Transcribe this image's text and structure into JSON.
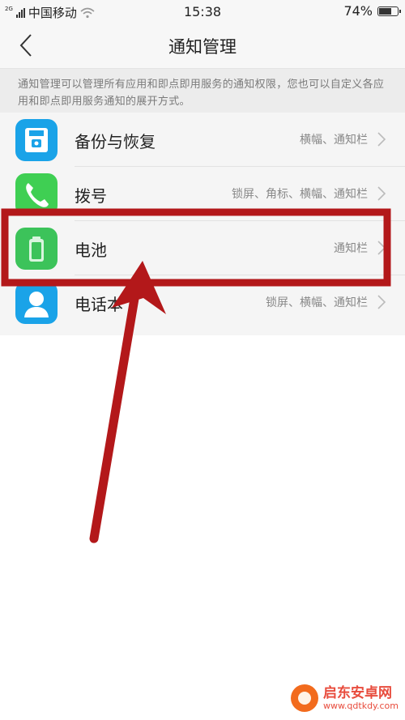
{
  "status": {
    "network": "2G",
    "carrier": "中国移动",
    "time": "15:38",
    "battery": "74%",
    "battery_level": 0.74
  },
  "nav": {
    "title": "通知管理"
  },
  "description": "通知管理可以管理所有应用和即点即用服务的通知权限，您也可以自定义各应用和即点即用服务通知的展开方式。",
  "apps": [
    {
      "label": "备份与恢复",
      "mode": "横幅、通知栏",
      "icon": "backup-icon",
      "color": "#1aa3e8"
    },
    {
      "label": "拨号",
      "mode": "锁屏、角标、横幅、通知栏",
      "icon": "phone-icon",
      "color": "#3fcf53"
    },
    {
      "label": "电池",
      "mode": "通知栏",
      "icon": "battery-icon",
      "color": "#3cc35a"
    },
    {
      "label": "电话本",
      "mode": "锁屏、横幅、通知栏",
      "icon": "contacts-icon",
      "color": "#1aa3e8"
    }
  ],
  "annotation_color": "#b3181a",
  "watermark": {
    "name": "启东安卓网",
    "url": "www.qdtkdy.com"
  }
}
